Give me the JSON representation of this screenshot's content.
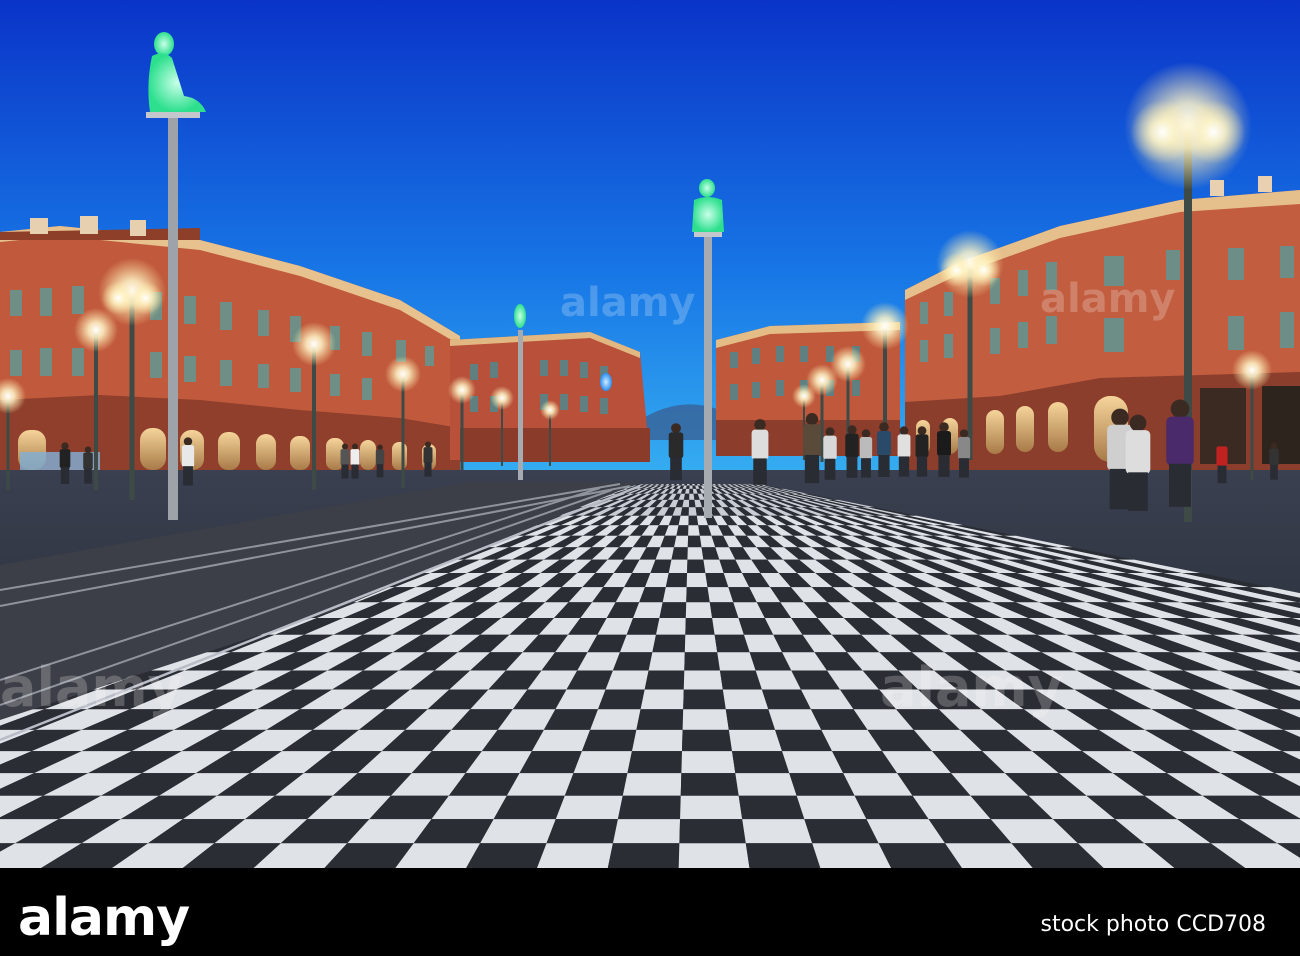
{
  "watermark": {
    "logo_text": "alamy"
  },
  "footer": {
    "logo_text": "alamy",
    "stock_photo_label": "stock photo",
    "image_code": "CCD708"
  },
  "colors": {
    "sky_top": "#0a3dd6",
    "sky_bottom": "#2aa7ee",
    "building": "#c25a3c",
    "lamp_glow": "#fff6d0",
    "statue_green": "#3cf0a0",
    "statue_blue": "#3aa8ff"
  }
}
